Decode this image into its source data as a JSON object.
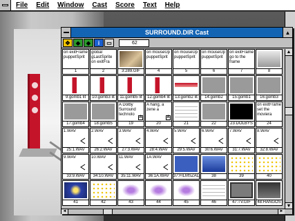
{
  "menubar": {
    "items": [
      "File",
      "Edit",
      "Window",
      "Cast",
      "Score",
      "Text",
      "Help"
    ]
  },
  "cast_window": {
    "title": "SURROUND.DIR Cast",
    "toolbar": {
      "field_value": "62"
    },
    "cells": [
      {
        "num": "1",
        "text": "on exitFrame\npuppetSprit"
      },
      {
        "num": "2",
        "text": "global\ngLastSprite\non exitFra"
      },
      {
        "num": "3:289.GIF",
        "text": ""
      },
      {
        "num": "4",
        "text": "on mouseUp\npuppetSprit"
      },
      {
        "num": "5",
        "text": "on mouseUp\npuppetSprit"
      },
      {
        "num": "6",
        "text": "on mouseUp\npuppetSprit"
      },
      {
        "num": "7",
        "text": "on exitFrame\ngo to the\nframe"
      },
      {
        "num": "8",
        "text": ""
      },
      {
        "num": "9:gomb1 lit",
        "text": ""
      },
      {
        "num": "10:gomb3 lit",
        "text": ""
      },
      {
        "num": "11:gomb5 lit",
        "text": ""
      },
      {
        "num": "12:gomb4 lit",
        "text": ""
      },
      {
        "num": "13:gomb2 lit",
        "text": ""
      },
      {
        "num": "14:gomb2",
        "text": ""
      },
      {
        "num": "15:gomb1",
        "text": ""
      },
      {
        "num": "16:gomb3",
        "text": ""
      },
      {
        "num": "17:gomb4",
        "text": ""
      },
      {
        "num": "18:gomb5",
        "text": ""
      },
      {
        "num": "19",
        "text": "A Dolby\nSurround\ntechnolo"
      },
      {
        "num": "20",
        "text": "A hang, a\nzene a"
      },
      {
        "num": "21",
        "text": ""
      },
      {
        "num": "22",
        "text": ""
      },
      {
        "num": "23:DOLBYS",
        "text": ""
      },
      {
        "num": "24",
        "text": "on exitFrame\nset the\nmoviera"
      },
      {
        "num": "25:1.WAV",
        "text": "1.WAV"
      },
      {
        "num": "26:2.WAV",
        "text": "2.WAV"
      },
      {
        "num": "27:3.WAV",
        "text": "3.WAV"
      },
      {
        "num": "28:4.WAV",
        "text": "4.WAV"
      },
      {
        "num": "29:5.WAV",
        "text": "5.WAV"
      },
      {
        "num": "30:6.WAV",
        "text": "6.WAV"
      },
      {
        "num": "31:7.WAV",
        "text": "7.WAV"
      },
      {
        "num": "32:8.WAV",
        "text": "8.WAV"
      },
      {
        "num": "33:9.WAV",
        "text": "9.WAV"
      },
      {
        "num": "34:10.WAV",
        "text": "10.WAV"
      },
      {
        "num": "35:11.WAV",
        "text": "11.WAV"
      },
      {
        "num": "36:1A.WAV",
        "text": "1A.WAV"
      },
      {
        "num": "37:FILMSZAL",
        "text": ""
      },
      {
        "num": "38",
        "text": ""
      },
      {
        "num": "39",
        "text": ""
      },
      {
        "num": "40",
        "text": ""
      },
      {
        "num": "41",
        "text": ""
      },
      {
        "num": "42",
        "text": ""
      },
      {
        "num": "43",
        "text": ""
      },
      {
        "num": "44",
        "text": ""
      },
      {
        "num": "45",
        "text": ""
      },
      {
        "num": "46",
        "text": ""
      },
      {
        "num": "47:TV.GIF",
        "text": ""
      },
      {
        "num": "48:HANGOS",
        "text": ""
      }
    ]
  },
  "colors": {
    "title_bar": "#1464b4",
    "speaker_red": "#c4142a"
  }
}
